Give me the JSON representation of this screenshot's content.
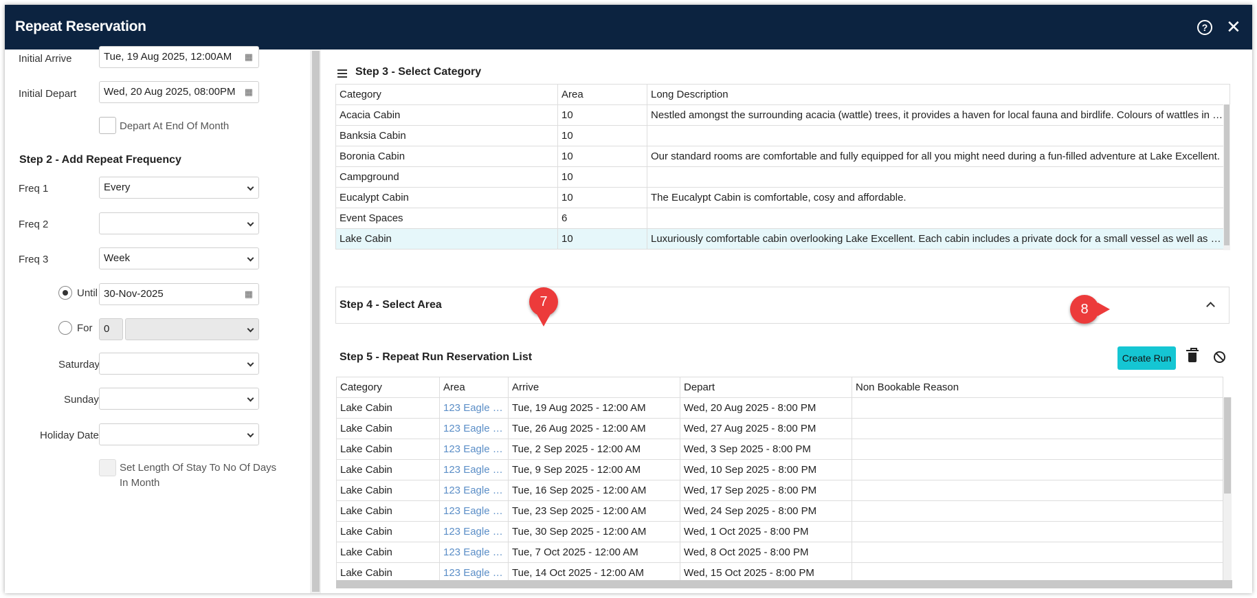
{
  "dialog": {
    "title": "Repeat Reservation",
    "help_icon": "question-icon",
    "close_icon": "close-icon"
  },
  "left": {
    "initial_arrive_label": "Initial Arrive",
    "initial_arrive_value": "Tue, 19 Aug 2025, 12:00AM",
    "initial_depart_label": "Initial Depart",
    "initial_depart_value": "Wed, 20 Aug 2025, 08:00PM",
    "depart_end_month_label": "Depart At End Of Month",
    "step2_heading": "Step 2 - Add Repeat Frequency",
    "freq1_label": "Freq 1",
    "freq1_value": "Every",
    "freq2_label": "Freq 2",
    "freq2_value": "",
    "freq3_label": "Freq 3",
    "freq3_value": "Week",
    "until_label": "Until",
    "until_value": "30-Nov-2025",
    "for_label": "For",
    "for_count": "0",
    "for_unit": "",
    "saturday_label": "Saturday",
    "saturday_value": "",
    "sunday_label": "Sunday",
    "sunday_value": "",
    "holiday_label": "Holiday Dates",
    "holiday_value": "",
    "set_length_line1": "Set Length Of Stay To No Of Days",
    "set_length_line2": "In Month"
  },
  "step3": {
    "heading": "Step 3 - Select Category",
    "columns": [
      "Category",
      "Area",
      "Long Description"
    ],
    "rows": [
      {
        "category": "Acacia Cabin",
        "area": "10",
        "description": "Nestled amongst the surrounding acacia (wattle) trees, it provides a haven for local fauna and birdlife. Colours of wattles in bl..."
      },
      {
        "category": "Banksia Cabin",
        "area": "10",
        "description": ""
      },
      {
        "category": "Boronia Cabin",
        "area": "10",
        "description": "Our standard rooms are comfortable and fully equipped for all you might need during a fun-filled adventure at Lake Excellent."
      },
      {
        "category": "Campground",
        "area": "10",
        "description": ""
      },
      {
        "category": "Eucalypt Cabin",
        "area": "10",
        "description": "The Eucalypt Cabin is comfortable, cosy and affordable."
      },
      {
        "category": "Event Spaces",
        "area": "6",
        "description": ""
      },
      {
        "category": "Lake Cabin",
        "area": "10",
        "description": "Luxuriously comfortable cabin overlooking Lake Excellent. Each cabin includes a private dock for a small vessel as well as a ba..."
      }
    ]
  },
  "step4": {
    "heading": "Step 4 - Select Area"
  },
  "step5": {
    "heading": "Step 5 - Repeat Run Reservation List",
    "create_run_label": "Create Run",
    "columns": [
      "Category",
      "Area",
      "Arrive",
      "Depart",
      "Non Bookable Reason"
    ],
    "rows": [
      {
        "category": "Lake Cabin",
        "area": "123 Eagle L...",
        "arrive": "Tue, 19 Aug 2025 - 12:00 AM",
        "depart": "Wed, 20 Aug 2025 - 8:00 PM",
        "reason": ""
      },
      {
        "category": "Lake Cabin",
        "area": "123 Eagle L...",
        "arrive": "Tue, 26 Aug 2025 - 12:00 AM",
        "depart": "Wed, 27 Aug 2025 - 8:00 PM",
        "reason": ""
      },
      {
        "category": "Lake Cabin",
        "area": "123 Eagle L...",
        "arrive": "Tue, 2 Sep 2025 - 12:00 AM",
        "depart": "Wed, 3 Sep 2025 - 8:00 PM",
        "reason": ""
      },
      {
        "category": "Lake Cabin",
        "area": "123 Eagle L...",
        "arrive": "Tue, 9 Sep 2025 - 12:00 AM",
        "depart": "Wed, 10 Sep 2025 - 8:00 PM",
        "reason": ""
      },
      {
        "category": "Lake Cabin",
        "area": "123 Eagle L...",
        "arrive": "Tue, 16 Sep 2025 - 12:00 AM",
        "depart": "Wed, 17 Sep 2025 - 8:00 PM",
        "reason": ""
      },
      {
        "category": "Lake Cabin",
        "area": "123 Eagle L...",
        "arrive": "Tue, 23 Sep 2025 - 12:00 AM",
        "depart": "Wed, 24 Sep 2025 - 8:00 PM",
        "reason": ""
      },
      {
        "category": "Lake Cabin",
        "area": "123 Eagle L...",
        "arrive": "Tue, 30 Sep 2025 - 12:00 AM",
        "depart": "Wed, 1 Oct 2025 - 8:00 PM",
        "reason": ""
      },
      {
        "category": "Lake Cabin",
        "area": "123 Eagle L...",
        "arrive": "Tue, 7 Oct 2025 - 12:00 AM",
        "depart": "Wed, 8 Oct 2025 - 8:00 PM",
        "reason": ""
      },
      {
        "category": "Lake Cabin",
        "area": "123 Eagle L...",
        "arrive": "Tue, 14 Oct 2025 - 12:00 AM",
        "depart": "Wed, 15 Oct 2025 - 8:00 PM",
        "reason": ""
      }
    ]
  },
  "callouts": {
    "seven": "7",
    "eight": "8"
  },
  "colors": {
    "titlebar": "#0c2340",
    "accent": "#15c6d3",
    "callout": "#ec3b3b",
    "link": "#5b8ec7",
    "selected_row": "#e6f7fa"
  }
}
